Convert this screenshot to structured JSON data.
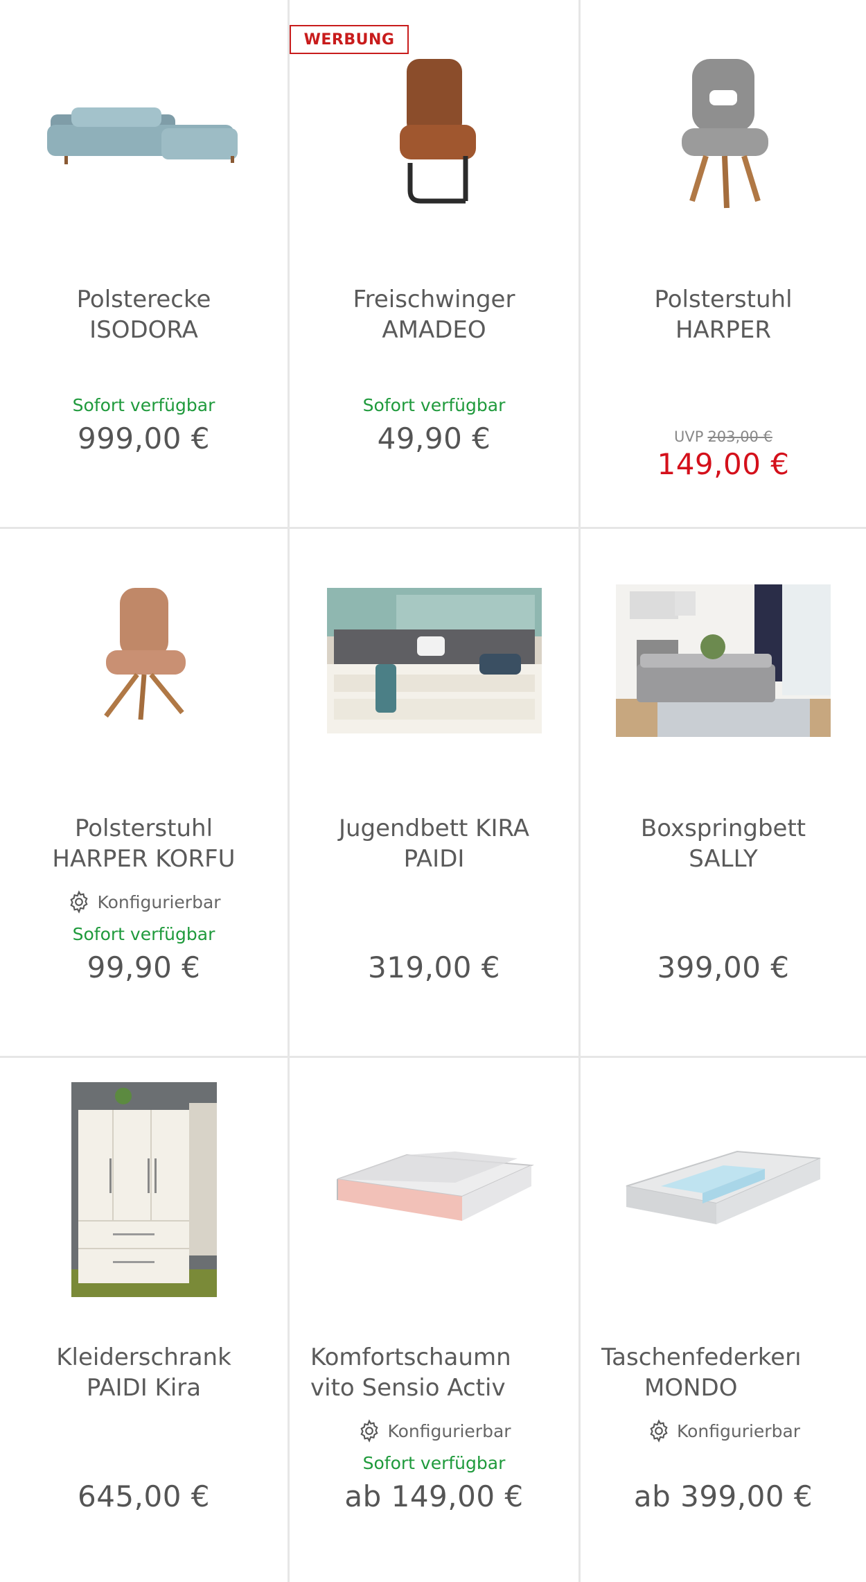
{
  "products": [
    {
      "ad_label": "",
      "title": [
        "Polsterecke",
        "ISODORA"
      ],
      "config": "",
      "availability": "Sofort verfügbar",
      "uvp_label": "",
      "uvp": "",
      "price": "999,00 €"
    },
    {
      "ad_label": "WERBUNG",
      "title": [
        "Freischwinger",
        "AMADEO"
      ],
      "config": "",
      "availability": "Sofort verfügbar",
      "uvp_label": "",
      "uvp": "",
      "price": "49,90 €"
    },
    {
      "ad_label": "",
      "title": [
        "Polsterstuhl",
        "HARPER"
      ],
      "config": "",
      "availability": "",
      "uvp_label": "UVP",
      "uvp": "203,00 €",
      "price": "149,00 €"
    },
    {
      "ad_label": "",
      "title": [
        "Polsterstuhl",
        "HARPER KORFU"
      ],
      "config": "Konfigurierbar",
      "availability": "Sofort verfügbar",
      "uvp_label": "",
      "uvp": "",
      "price": "99,90 €"
    },
    {
      "ad_label": "",
      "title": [
        "Jugendbett KIRA",
        "PAIDI"
      ],
      "config": "",
      "availability": "",
      "uvp_label": "",
      "uvp": "",
      "price": "319,00 €"
    },
    {
      "ad_label": "",
      "title": [
        "Boxspringbett",
        "SALLY"
      ],
      "config": "",
      "availability": "",
      "uvp_label": "",
      "uvp": "",
      "price": "399,00 €"
    },
    {
      "ad_label": "",
      "title": [
        "Kleiderschrank",
        "PAIDI Kira"
      ],
      "config": "",
      "availability": "",
      "uvp_label": "",
      "uvp": "",
      "price": "645,00 €"
    },
    {
      "ad_label": "",
      "title": [
        "Komfortschaumn",
        "vito Sensio Activ"
      ],
      "config": "Konfigurierbar",
      "availability": "Sofort verfügbar",
      "uvp_label": "",
      "uvp": "",
      "price": "ab 149,00 €"
    },
    {
      "ad_label": "",
      "title": [
        "Taschenfederkerı",
        "MONDO"
      ],
      "config": "Konfigurierbar",
      "availability": "",
      "uvp_label": "",
      "uvp": "",
      "price": "ab 399,00 €"
    }
  ],
  "colors": {
    "available": "#1f9a3c",
    "sale": "#d4101b",
    "ad_border": "#c81c1c",
    "divider": "#e6e6e6"
  },
  "icons": {
    "config": "gear-icon"
  }
}
